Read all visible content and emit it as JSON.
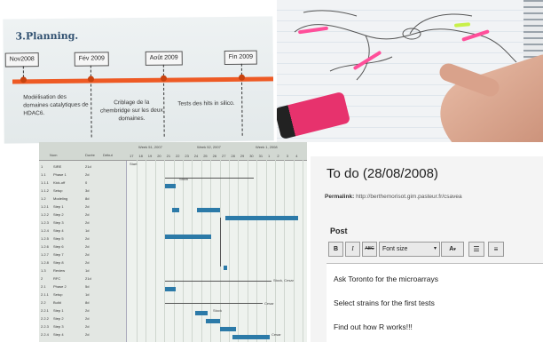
{
  "planning": {
    "title": "3.Planning.",
    "milestones": [
      {
        "date": "Nov2008",
        "text": "Modélisation des domaines catalytiques de HDAC6."
      },
      {
        "date": "Fév 2009",
        "text": "Criblage de la chembridge sur les deux domaines."
      },
      {
        "date": "Août 2009",
        "text": "Tests des hits in silico."
      },
      {
        "date": "Fin 2009",
        "text": ""
      }
    ]
  },
  "gantt": {
    "columns": [
      "Nom",
      "Durée",
      "Début"
    ],
    "months": [
      "Week 51, 2007",
      "Week 52, 2007",
      "Week 1, 2008"
    ],
    "days": [
      "17",
      "18",
      "19",
      "20",
      "21",
      "22",
      "23",
      "24",
      "25",
      "26",
      "27",
      "28",
      "29",
      "30",
      "31",
      "1",
      "2",
      "3",
      "4"
    ],
    "rows": [
      {
        "id": "1",
        "name": "SIRE",
        "dur": "21d"
      },
      {
        "id": "1.1",
        "name": "Phase 1",
        "dur": "2d"
      },
      {
        "id": "1.1.1",
        "name": "Kick-off",
        "dur": "0"
      },
      {
        "id": "1.1.2",
        "name": "Setup",
        "dur": "3d"
      },
      {
        "id": "1.2",
        "name": "Modeling",
        "dur": "8d"
      },
      {
        "id": "1.2.1",
        "name": "Step 1",
        "dur": "2d"
      },
      {
        "id": "1.2.2",
        "name": "Step 2",
        "dur": "2d"
      },
      {
        "id": "1.2.3",
        "name": "Step 3",
        "dur": "2d"
      },
      {
        "id": "1.2.4",
        "name": "Step 4",
        "dur": "1d"
      },
      {
        "id": "1.2.5",
        "name": "Step 5",
        "dur": "2d"
      },
      {
        "id": "1.2.6",
        "name": "Step 6",
        "dur": "2d"
      },
      {
        "id": "1.2.7",
        "name": "Step 7",
        "dur": "2d"
      },
      {
        "id": "1.2.8",
        "name": "Step 8",
        "dur": "2d"
      },
      {
        "id": "1.3",
        "name": "Review",
        "dur": "1d"
      },
      {
        "id": "2",
        "name": "RFC",
        "dur": "21d"
      },
      {
        "id": "2.1",
        "name": "Phase 2",
        "dur": "5d"
      },
      {
        "id": "2.1.1",
        "name": "Setup",
        "dur": "1d"
      },
      {
        "id": "2.2",
        "name": "Build",
        "dur": "8d"
      },
      {
        "id": "2.2.1",
        "name": "Step 1",
        "dur": "2d"
      },
      {
        "id": "2.2.2",
        "name": "Step 2",
        "dur": "2d"
      },
      {
        "id": "2.2.3",
        "name": "Step 3",
        "dur": "2d"
      },
      {
        "id": "2.2.4",
        "name": "Step 4",
        "dur": "2d"
      }
    ],
    "labels": [
      "Start",
      "Stock",
      "Stock, Cesar",
      "Cesar",
      "Stock",
      "Cesar"
    ]
  },
  "blog": {
    "title": "To do (28/08/2008)",
    "permalink_label": "Permalink:",
    "permalink_url": "http://berthemorisot.gim.pasteur.fr/csavea",
    "post_label": "Post",
    "toolbar": {
      "bold": "B",
      "italic": "I",
      "strike": "ABC",
      "font_size": "Font size",
      "font_color": "A"
    },
    "lines": [
      "Ask Toronto for the microarrays",
      "Select strains for the first tests",
      "Find out how R works!!!"
    ]
  }
}
